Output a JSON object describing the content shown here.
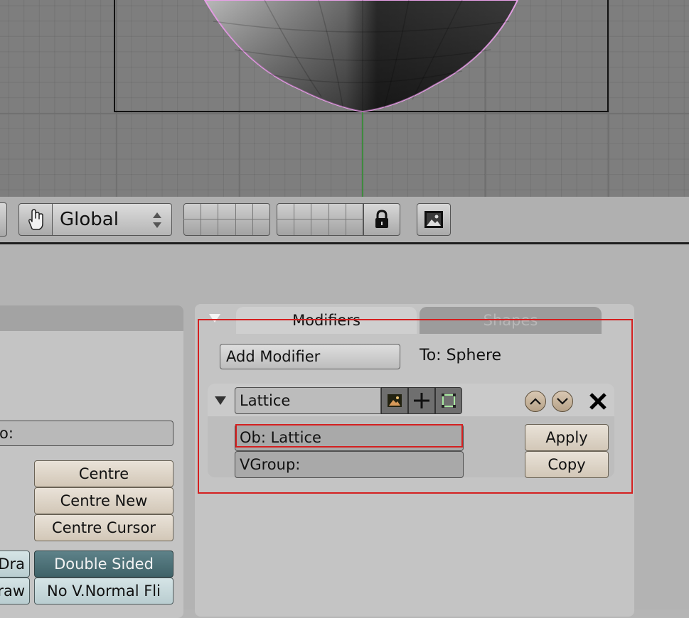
{
  "header": {
    "coord_select": "Global"
  },
  "tabs": {
    "modifiers": "Modifiers",
    "shapes": "Shapes"
  },
  "modifier_panel": {
    "add_button": "Add Modifier",
    "target": "To: Sphere",
    "modifier": {
      "name": "Lattice",
      "object_field": "Ob: Lattice",
      "vgroup_field": "VGroup:",
      "apply_button": "Apply",
      "copy_button": "Copy"
    }
  },
  "left_panel": {
    "partial_field": "o:",
    "centre_button": "Centre",
    "centre_new_button": "Centre New",
    "centre_cursor_button": "Centre Cursor",
    "partial_left_1": "Dra",
    "partial_left_2": "raw",
    "double_sided": "Double Sided",
    "no_vnormal_flip": "No V.Normal Fli"
  },
  "colors": {
    "highlight_box": "#d42020",
    "selection_outline": "#e8a0e8",
    "toggle_on": "#4e7278"
  }
}
